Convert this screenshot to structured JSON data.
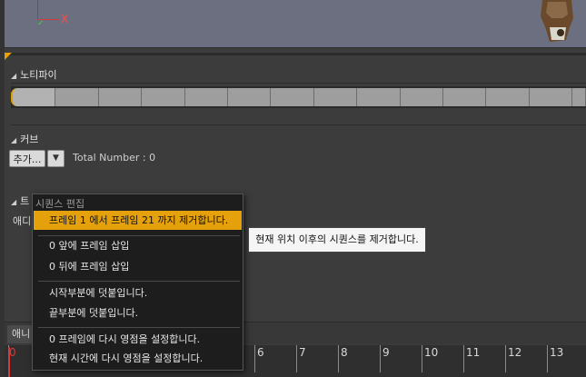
{
  "viewport": {
    "axis_x_label": "X"
  },
  "sections": {
    "notify_title": "노티파이",
    "curve_title": "커브",
    "track_title_partial": "트",
    "anim_label_partial": "애디",
    "timeline_tab_partial": "애니"
  },
  "curve": {
    "add_button": "추가...",
    "total_number": "Total Number : 0"
  },
  "timeline": {
    "ticks": [
      "0",
      "6",
      "7",
      "8",
      "9",
      "10",
      "11",
      "12",
      "13"
    ]
  },
  "menu": {
    "header": "시퀀스 편집",
    "items": [
      "프레임 1 에서 프레임 21 까지 제거합니다.",
      "0 앞에 프레임 삽입",
      "0 뒤에 프레임 삽입",
      "시작부분에 덧붙입니다.",
      "끝부분에 덧붙입니다.",
      "0 프레임에 다시 영점을 설정합니다.",
      "현재 시간에 다시 영점을 설정합니다."
    ],
    "highlighted_index": 0
  },
  "tooltip": {
    "text": "현재 위치 이후의 시퀀스를 제거합니다."
  },
  "colors": {
    "accent": "#e4a10c",
    "viewport": "#6c6f80",
    "panel": "#3c3c3c",
    "marker": "#d53a3a"
  }
}
